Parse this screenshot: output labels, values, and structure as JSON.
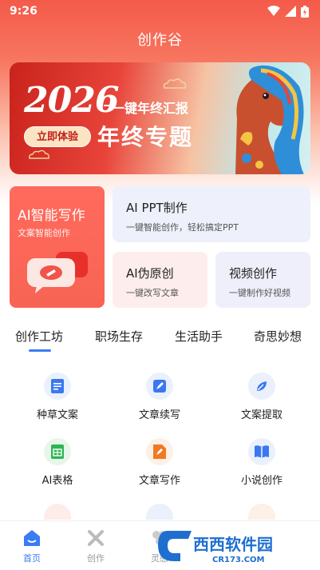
{
  "status": {
    "time": "9:26"
  },
  "header": {
    "title": "创作谷"
  },
  "banner": {
    "year": "2026",
    "line1": "一键年终汇报",
    "line2": "年终专题",
    "cta": "立即体验"
  },
  "cards": {
    "ai_write": {
      "title": "AI智能写作",
      "subtitle": "文案智能创作"
    },
    "ppt": {
      "title": "AI PPT制作",
      "subtitle": "一键智能创作，轻松搞定PPT"
    },
    "fake_original": {
      "title": "AI伪原创",
      "subtitle": "一键改写文章"
    },
    "video": {
      "title": "视频创作",
      "subtitle": "一键制作好视频"
    }
  },
  "tabs": [
    "创作工坊",
    "职场生存",
    "生活助手",
    "奇思妙想"
  ],
  "tools": [
    {
      "label": "种草文案",
      "icon": "document-icon",
      "bg": "#eaf1fd",
      "fg": "#3b78f0"
    },
    {
      "label": "文章续写",
      "icon": "edit-icon",
      "bg": "#eaf1fd",
      "fg": "#3b78f0"
    },
    {
      "label": "文案提取",
      "icon": "leaf-icon",
      "bg": "#eaf1fd",
      "fg": "#3b78f0"
    },
    {
      "label": "AI表格",
      "icon": "table-icon",
      "bg": "#e6f7ea",
      "fg": "#2fb457"
    },
    {
      "label": "文章写作",
      "icon": "pen-doc-icon",
      "bg": "#fdf0e6",
      "fg": "#f07a23"
    },
    {
      "label": "小说创作",
      "icon": "book-icon",
      "bg": "#eaf1fd",
      "fg": "#3b78f0"
    }
  ],
  "nav": [
    {
      "label": "首页",
      "icon": "home-icon",
      "active": true
    },
    {
      "label": "创作",
      "icon": "tools-icon",
      "active": false
    },
    {
      "label": "灵感",
      "icon": "inspiration-icon",
      "active": false
    }
  ],
  "watermark": {
    "brand": "西西软件园",
    "url": "CR173.COM"
  },
  "colors": {
    "accent": "#3a7bf6",
    "primary": "#f45a4a"
  }
}
